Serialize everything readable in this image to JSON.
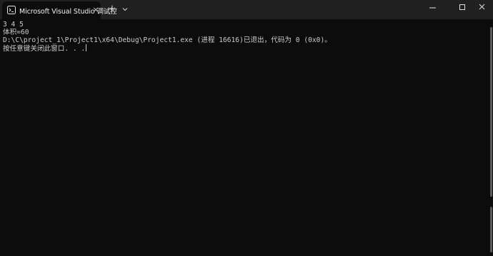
{
  "window": {
    "tab_title": "Microsoft Visual Studio 调试控",
    "close_tab_glyph": "×",
    "new_tab_glyph": "+"
  },
  "console": {
    "lines": [
      "3 4 5",
      "体积=60",
      "D:\\C\\project_1\\Project1\\x64\\Debug\\Project1.exe (进程 16616)已退出，代码为 0 (0x0)。",
      "按任意键关闭此窗口. . ."
    ]
  },
  "icons": {
    "tab_icon": "terminal-icon",
    "dropdown_icon": "chevron-down-icon",
    "minimize_icon": "minimize-icon",
    "maximize_icon": "maximize-icon",
    "close_icon": "close-icon"
  },
  "colors": {
    "titlebar": "#202020",
    "console_background": "#0c0c0c",
    "console_text": "#cccccc"
  }
}
